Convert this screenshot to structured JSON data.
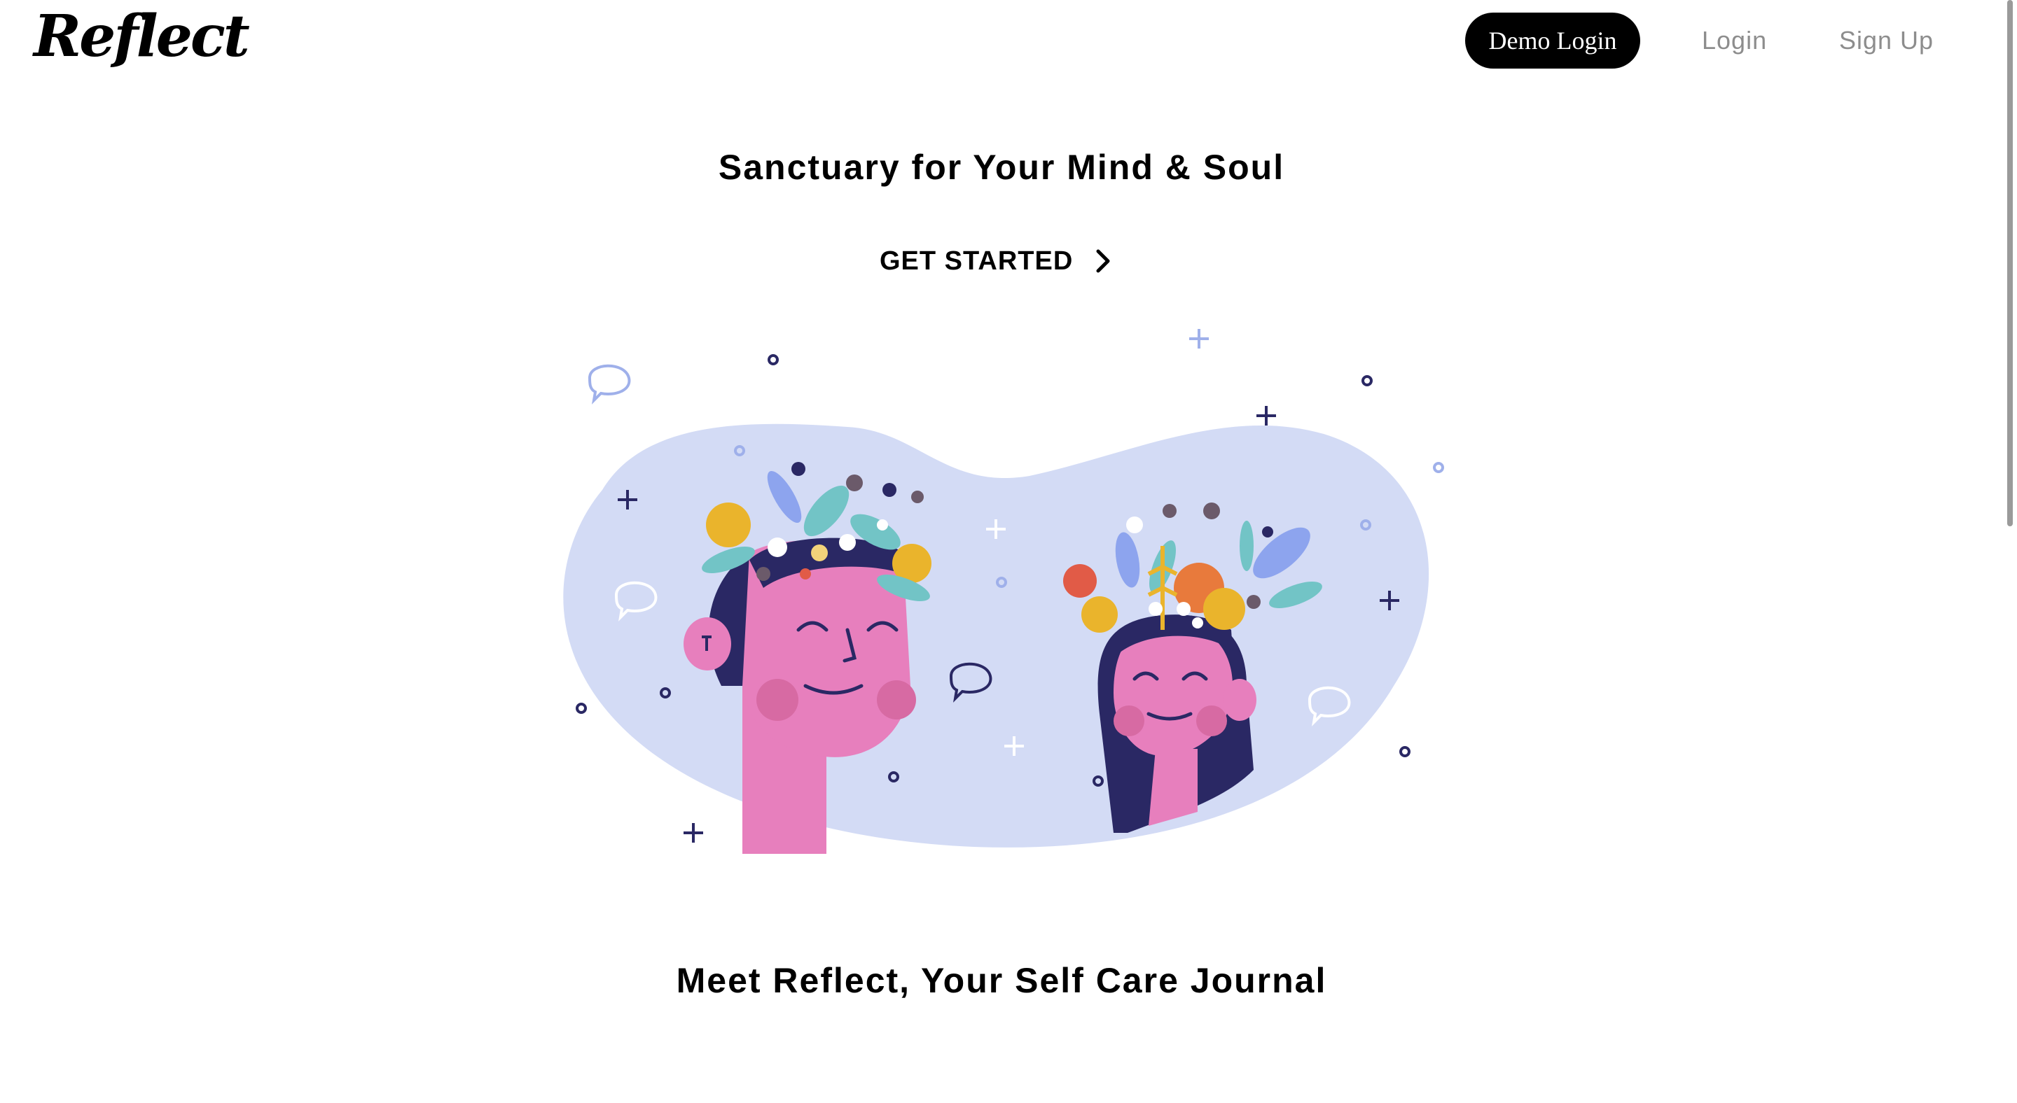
{
  "header": {
    "logo_text": "Reflect",
    "nav": {
      "demo_login": "Demo Login",
      "login": "Login",
      "sign_up": "Sign Up"
    }
  },
  "hero": {
    "title": "Sanctuary for Your Mind & Soul",
    "cta_label": "GET STARTED",
    "cta_icon": "chevron-right-icon",
    "illustration": "two-heads-with-flowers-illustration"
  },
  "section": {
    "title": "Meet Reflect, Your Self Care Journal"
  },
  "colors": {
    "brand": "#000000",
    "nav_muted": "#8d8d8d",
    "blob": "#d3dbf5",
    "skin": "#e77fbd",
    "hair": "#2a2864",
    "accent_yellow": "#eab42c"
  }
}
